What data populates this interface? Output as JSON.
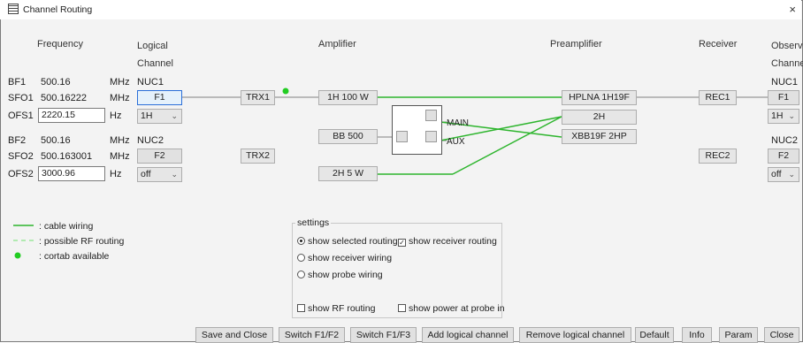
{
  "window": {
    "title": "Channel Routing",
    "close_glyph": "×"
  },
  "headers": {
    "frequency": "Frequency",
    "logical_channel_1": "Logical",
    "logical_channel_2": "Channel",
    "amplifier": "Amplifier",
    "preamplifier": "Preamplifier",
    "receiver": "Receiver",
    "observe_1": "Observe",
    "observe_2": "Channel"
  },
  "rows": {
    "bf1": {
      "label": "BF1",
      "value": "500.16",
      "unit": "MHz"
    },
    "sfo1": {
      "label": "SFO1",
      "value": "500.16222",
      "unit": "MHz"
    },
    "ofs1": {
      "label": "OFS1",
      "value": "2220.15",
      "unit": "Hz"
    },
    "bf2": {
      "label": "BF2",
      "value": "500.16",
      "unit": "MHz"
    },
    "sfo2": {
      "label": "SFO2",
      "value": "500.163001",
      "unit": "MHz"
    },
    "ofs2": {
      "label": "OFS2",
      "value": "3000.96",
      "unit": "Hz"
    }
  },
  "logical": {
    "nuc1": "NUC1",
    "f1": "F1",
    "nuc1_select": "1H",
    "nuc2": "NUC2",
    "f2": "F2",
    "nuc2_select": "off"
  },
  "transmitters": {
    "trx1": "TRX1",
    "trx2": "TRX2"
  },
  "amplifiers": {
    "amp1": "1H 100 W",
    "amp2": "BB 500",
    "amp3": "2H 5 W"
  },
  "switch": {
    "main": "MAIN",
    "aux": "AUX"
  },
  "preamps": {
    "p1": "HPLNA 1H19F",
    "p2": "2H",
    "p3": "XBB19F 2HP"
  },
  "receivers": {
    "rec1": "REC1",
    "rec2": "REC2"
  },
  "observe": {
    "nuc1": "NUC1",
    "f1": "F1",
    "nuc1_select": "1H",
    "nuc2": "NUC2",
    "f2": "F2",
    "nuc2_select": "off"
  },
  "legend": {
    "cable": ": cable wiring",
    "possible": ": possible RF routing",
    "cortab": ": cortab available"
  },
  "settings": {
    "title": "settings",
    "show_selected_routing": "show selected routing",
    "show_receiver_routing": "show receiver routing",
    "show_receiver_wiring": "show receiver wiring",
    "show_probe_wiring": "show probe wiring",
    "show_rf_routing": "show RF routing",
    "show_power_at_probe_in": "show power at probe in"
  },
  "buttons": {
    "save_and_close": "Save and Close",
    "switch_f1f2": "Switch F1/F2",
    "switch_f1f3": "Switch F1/F3",
    "add_logical_channel": "Add logical channel",
    "remove_logical_channel": "Remove logical channel",
    "default": "Default",
    "info": "Info",
    "param": "Param",
    "close": "Close"
  },
  "colors": {
    "wire": "#2db52d",
    "line": "#808080",
    "accent": "#2b6fd8"
  }
}
